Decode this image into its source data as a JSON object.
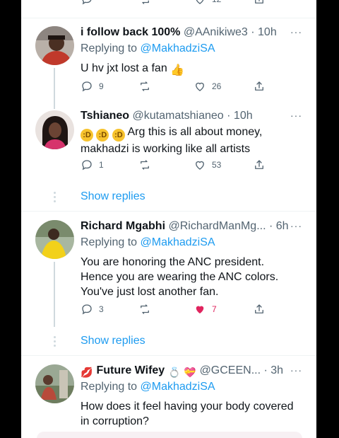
{
  "prev_tweet": {
    "like_count": "12"
  },
  "tweets": [
    {
      "display_name": "i follow back 100%",
      "handle": "@AAnikiwe3",
      "time": "· 10h",
      "replying_label": "Replying to",
      "replying_to": "@MakhadziSA",
      "text": "U hv jxt lost a fan",
      "emoji": "thumbs-up",
      "reply_count": "9",
      "retweet_count": "",
      "like_count": "26"
    },
    {
      "display_name": "Tshianeo",
      "handle": "@kutamatshianeo",
      "time": "· 10h",
      "text_line1": "Arg this is all about money,",
      "text_line2": "makhadzi is working like all artists",
      "reply_count": "1",
      "retweet_count": "",
      "like_count": "53"
    },
    {
      "display_name": "Richard Mgabhi",
      "handle": "@RichardManMg...",
      "time": "· 6h",
      "replying_label": "Replying to",
      "replying_to": "@MakhadziSA",
      "text_line1": "You are honoring the ANC president.",
      "text_line2": "Hence you are wearing the ANC colors.",
      "text_line3": "You've just lost another fan.",
      "reply_count": "3",
      "retweet_count": "",
      "like_count": "7",
      "liked": true
    },
    {
      "display_name": "Future Wifey",
      "handle": "@GCEEN...",
      "time": "· 3h",
      "replying_label": "Replying to",
      "replying_to": "@MakhadziSA",
      "text_line1": "How does it feel having your body covered",
      "text_line2": "in corruption?"
    }
  ],
  "show_replies_label": "Show replies",
  "more_label": "···",
  "colors": {
    "accent": "#1d9bf0",
    "like": "#e0245e",
    "muted": "#536471",
    "divider": "#eff3f4"
  }
}
